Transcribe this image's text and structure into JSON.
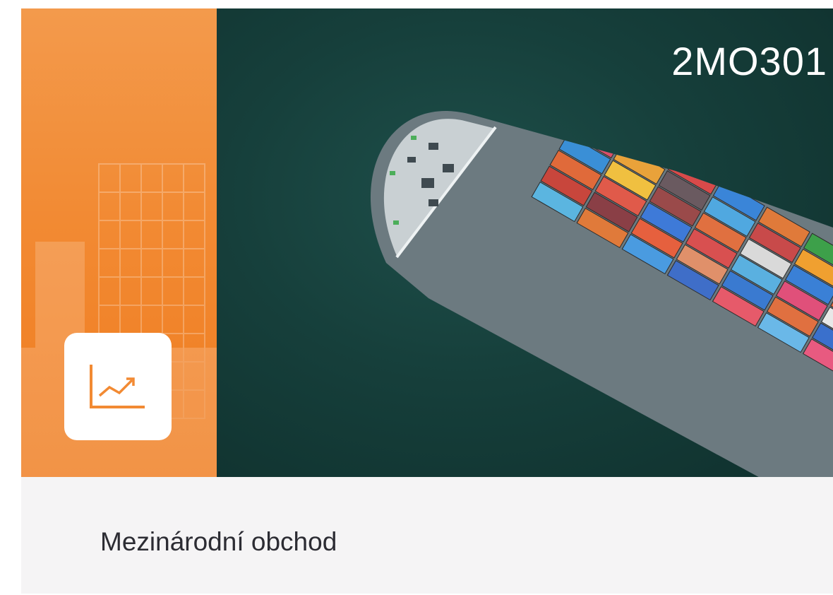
{
  "course": {
    "code": "2MO301",
    "title": "Mezinárodní obchod"
  },
  "icons": {
    "course_icon": "line-chart-trend-icon"
  },
  "colors": {
    "accent_orange": "#F28A33",
    "sea": "#163F3B",
    "card_background": "#F5F4F5",
    "title_text": "#2C2C33"
  }
}
